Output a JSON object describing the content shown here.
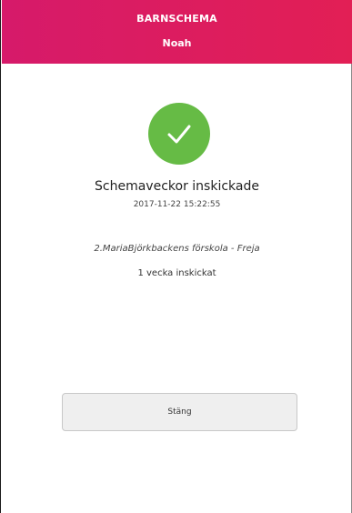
{
  "header": {
    "title": "BARNSCHEMA",
    "child_name": "Noah"
  },
  "status": {
    "icon": "checkmark-circle-icon",
    "title": "Schemaveckor inskickade",
    "timestamp": "2017-11-22 15:22:55",
    "school": "2.MariaBjörkbackens förskola - Freja",
    "weeks_sent": "1 vecka inskickat"
  },
  "actions": {
    "close_label": "Stäng"
  },
  "colors": {
    "header_from": "#d61a6a",
    "header_to": "#e21f55",
    "success": "#66bb45"
  }
}
